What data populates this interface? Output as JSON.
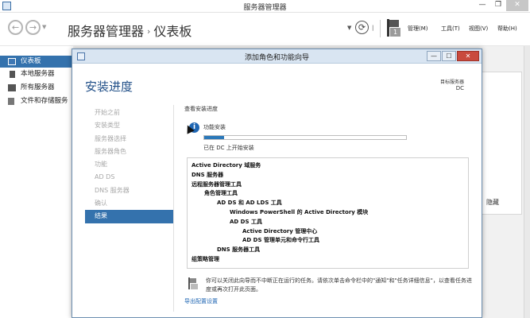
{
  "window": {
    "title": "服务器管理器"
  },
  "header": {
    "breadcrumb_root": "服务器管理器",
    "breadcrumb_sep": "›",
    "breadcrumb_page": "仪表板",
    "flag_badge": "1",
    "menus": [
      "管理(M)",
      "工具(T)",
      "视图(V)",
      "帮助(H)"
    ]
  },
  "sidebar": {
    "items": [
      {
        "label": "仪表板"
      },
      {
        "label": "本地服务器"
      },
      {
        "label": "所有服务器"
      },
      {
        "label": "文件和存储服务"
      }
    ]
  },
  "background": {
    "hide_label": "隐藏"
  },
  "wizard": {
    "title": "添加角色和功能向导",
    "heading": "安装进度",
    "dest_label": "目标服务器",
    "dest_server": "DC",
    "steps": [
      {
        "label": "开始之前",
        "active": false
      },
      {
        "label": "安装类型",
        "active": false
      },
      {
        "label": "服务器选择",
        "active": false
      },
      {
        "label": "服务器角色",
        "active": false
      },
      {
        "label": "功能",
        "active": false
      },
      {
        "label": "AD DS",
        "active": false
      },
      {
        "label": "DNS 服务器",
        "active": false
      },
      {
        "label": "确认",
        "active": false
      },
      {
        "label": "结果",
        "active": true
      }
    ],
    "view_progress": "查看安装进度",
    "feature_install": "功能安装",
    "progress_fraction": 0.1,
    "progress_status": "已在 DC 上开始安装",
    "results": [
      {
        "text": "Active Directory 域服务",
        "level": 0
      },
      {
        "text": "DNS 服务器",
        "level": 0
      },
      {
        "text": "远程服务器管理工具",
        "level": 0
      },
      {
        "text": "角色管理工具",
        "level": 1
      },
      {
        "text": "AD DS 和 AD LDS 工具",
        "level": 2
      },
      {
        "text": "Windows PowerShell 的 Active Directory 模块",
        "level": 3
      },
      {
        "text": "AD DS 工具",
        "level": 3
      },
      {
        "text": "Active Directory 管理中心",
        "level": 4
      },
      {
        "text": "AD DS 管理单元和命令行工具",
        "level": 4
      },
      {
        "text": "DNS 服务器工具",
        "level": 2
      },
      {
        "text": "组策略管理",
        "level": 0
      }
    ],
    "note": "你可以关闭此向导而不中断正在运行的任务。请依次单击命令栏中的\"通知\"和\"任务详细信息\"，以查看任务进度或再次打开此页面。",
    "export_link": "导出配置设置"
  }
}
